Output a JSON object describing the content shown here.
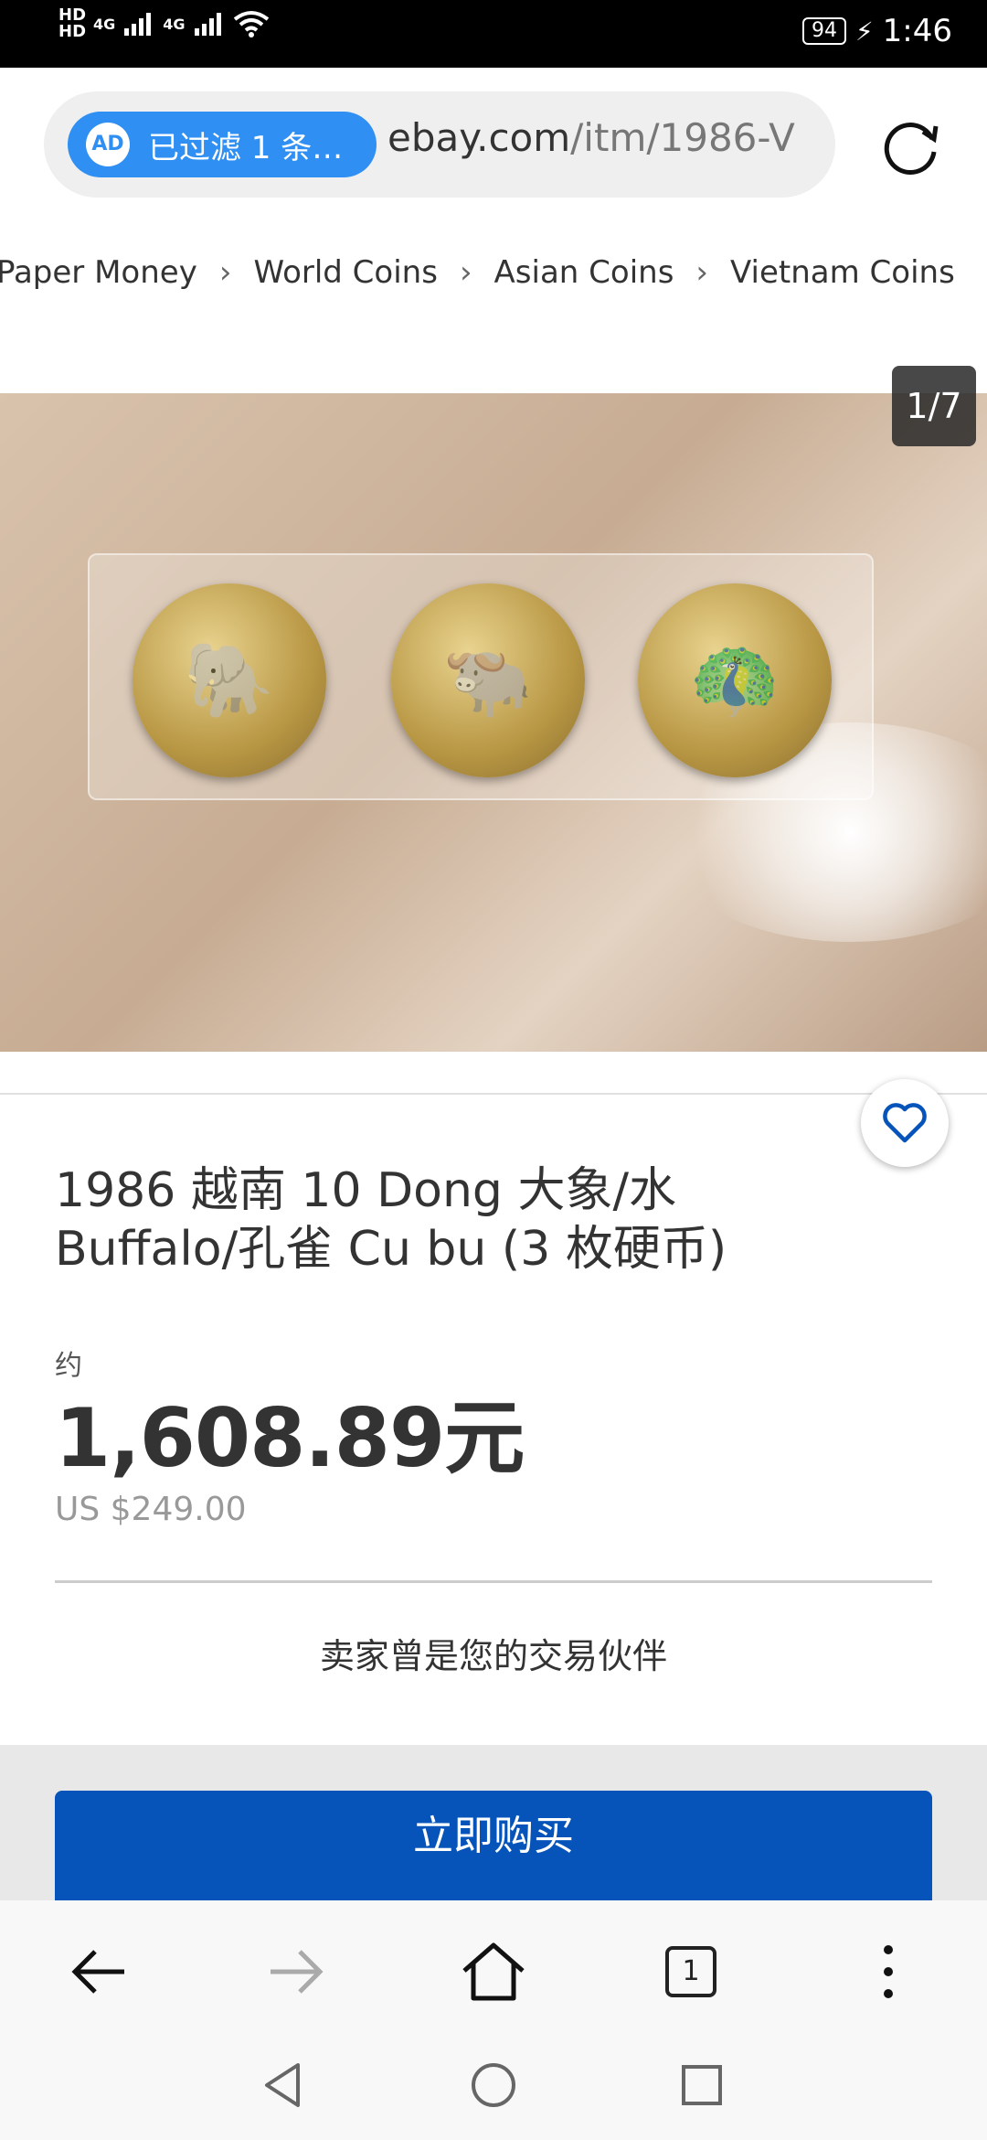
{
  "status_bar": {
    "hd1": "HD",
    "hd2": "HD",
    "net1": "4G",
    "net2": "4G",
    "battery": "94",
    "time": "1:46"
  },
  "address_bar": {
    "ad_filter": "已过滤 1 条…",
    "ad_icon": "AD",
    "url_domain": "ebay.com",
    "url_path": "/itm/1986-V"
  },
  "breadcrumbs": [
    "Paper Money",
    "World Coins",
    "Asian Coins",
    "Vietnam Coins"
  ],
  "image_counter": "1/7",
  "listing": {
    "title": "1986 越南 10 Dong 大象/水 Buffalo/孔雀 Cu bu (3 枚硬币)",
    "approx_label": "约",
    "price_cny": "1,608.89元",
    "price_usd": "US $249.00",
    "partner_note": "卖家曾是您的交易伙伴",
    "buy_now": "立即购买"
  },
  "browser": {
    "tab_count": "1"
  },
  "colors": {
    "accent": "#0654ba",
    "ad_pill": "#2f8ff2",
    "fav_heart": "#0654ba"
  },
  "icons": [
    "reload-icon",
    "chevron-right-icon",
    "heart-icon",
    "back-arrow-icon",
    "forward-arrow-icon",
    "home-icon",
    "tabs-icon",
    "more-vert-icon",
    "nav-back-icon",
    "nav-home-icon",
    "nav-recents-icon"
  ]
}
